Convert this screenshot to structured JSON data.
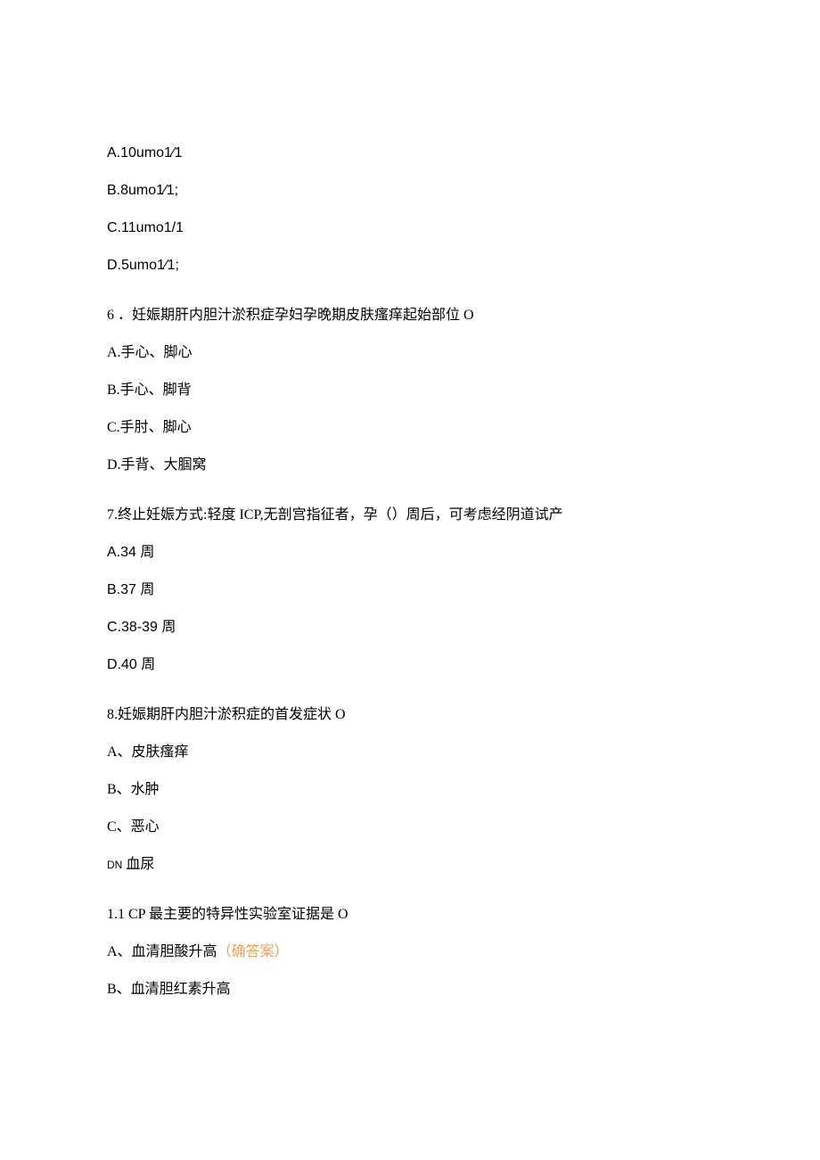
{
  "q5": {
    "optA": "A.10umo1⁄1",
    "optB": "B.8umo1⁄1;",
    "optC": "C.11umo1/1",
    "optD": "D.5umo1⁄1;"
  },
  "q6": {
    "text": "6 ．妊娠期肝内胆汁淤积症孕妇孕晚期皮肤瘙痒起始部位 O",
    "optA": "A.手心、脚心",
    "optB": "B.手心、脚背",
    "optC": "C.手肘、脚心",
    "optD": "D.手背、大腘窝"
  },
  "q7": {
    "text": "7.终止妊娠方式:轻度 ICP,无剖宫指征者，孕（）周后，可考虑经阴道试产",
    "optA": "A.34 周",
    "optB": "B.37 周",
    "optC": "C.38-39 周",
    "optD": "D.40 周"
  },
  "q8": {
    "text": "8.妊娠期肝内胆汁淤积症的首发症状 O",
    "optA": "A、皮肤瘙痒",
    "optB": "B、水肿",
    "optC": "C、恶心",
    "optD_prefix": "DN",
    "optD_rest": " 血尿"
  },
  "q11": {
    "text": "1.1  CP 最主要的特异性实验室证据是 O",
    "optA": "A、血清胆酸升高",
    "answer_mark": "（确答案）",
    "optB": "B、血清胆红素升高"
  }
}
